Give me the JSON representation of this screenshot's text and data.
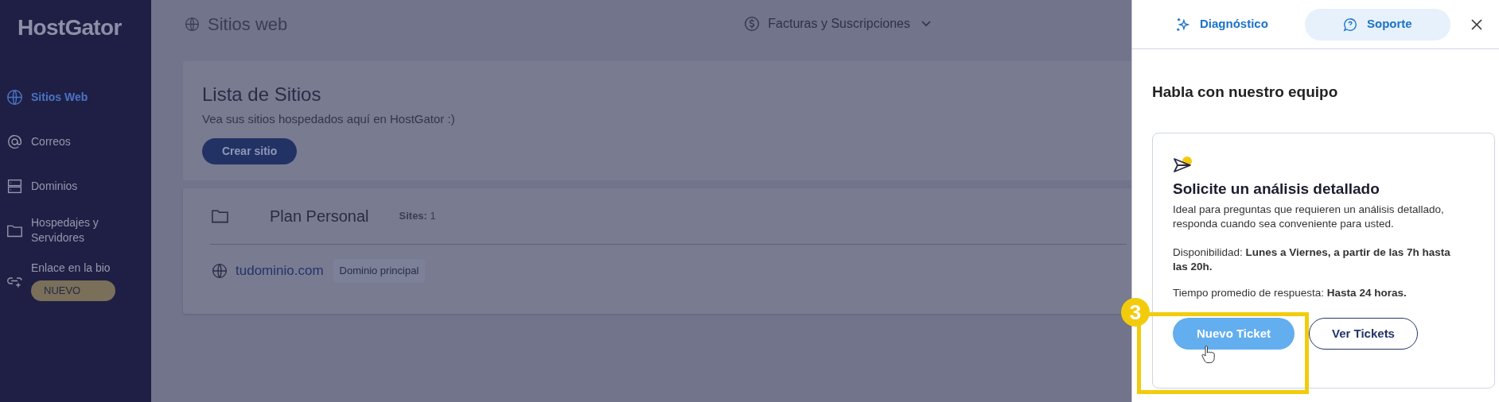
{
  "sidebar": {
    "logo": "HostGator",
    "items": [
      {
        "kind": "globe",
        "label": "Sitios Web",
        "selected": true
      },
      {
        "kind": "at",
        "label": "Correos",
        "selected": false
      },
      {
        "kind": "server",
        "label": "Dominios",
        "selected": false
      },
      {
        "kind": "folder",
        "label": "Hospedajes y Servidores",
        "selected": false
      },
      {
        "kind": "link",
        "label": "Enlace en la bio",
        "selected": false,
        "badge": "NUEVO"
      }
    ]
  },
  "header": {
    "title": "Sitios web",
    "menu": "Facturas y Suscripciones"
  },
  "site_list": {
    "title": "Lista de Sitios",
    "subtitle": "Vea sus sitios hospedados aquí en HostGator :)",
    "button": "Crear sitio"
  },
  "plan": {
    "name": "Plan Personal",
    "sites": "**Sites:** 1",
    "domain": "tudominio.com",
    "domain_tag": "Dominio principal"
  },
  "panel": {
    "tabs": [
      {
        "kind": "sparkle",
        "label": "Diagnóstico",
        "selected": false
      },
      {
        "kind": "chat",
        "label": "Soporte",
        "selected": true
      }
    ],
    "heading": "Habla con nuestro equipo",
    "card": {
      "title": "Solicite un análisis detallado",
      "description": "Ideal para preguntas que requieren un análisis detallado, responda cuando sea conveniente para usted.",
      "availability": "Disponibilidad: **Lunes a Viernes, a partir de las 7h hasta las 20h.**",
      "response_time": "Tiempo promedio de respuesta: **Hasta 24 horas.**",
      "buttons": [
        {
          "kind": "primary",
          "label": "Nuevo Ticket"
        },
        {
          "kind": "outline",
          "label": "Ver Tickets"
        }
      ]
    }
  },
  "annotation": {
    "step": "3"
  }
}
